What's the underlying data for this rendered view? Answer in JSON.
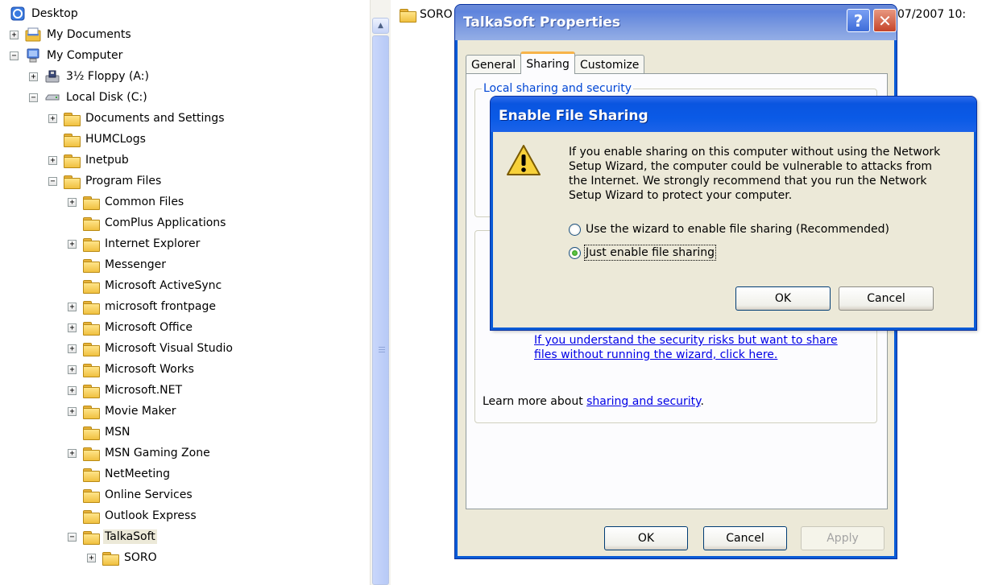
{
  "tree": {
    "items": [
      {
        "label": "Desktop",
        "indent": 0,
        "expander": "",
        "icon": "desktop-icon"
      },
      {
        "label": "My Documents",
        "indent": 0,
        "expander": "+",
        "icon": "my-documents-icon"
      },
      {
        "label": "My Computer",
        "indent": 0,
        "expander": "−",
        "icon": "my-computer-icon"
      },
      {
        "label": "3½ Floppy (A:)",
        "indent": 1,
        "expander": "+",
        "icon": "floppy-drive-icon"
      },
      {
        "label": "Local Disk (C:)",
        "indent": 1,
        "expander": "−",
        "icon": "hard-disk-icon"
      },
      {
        "label": "Documents and Settings",
        "indent": 2,
        "expander": "+",
        "icon": "folder-icon"
      },
      {
        "label": "HUMCLogs",
        "indent": 2,
        "expander": "",
        "icon": "folder-icon"
      },
      {
        "label": "Inetpub",
        "indent": 2,
        "expander": "+",
        "icon": "folder-icon"
      },
      {
        "label": "Program Files",
        "indent": 2,
        "expander": "−",
        "icon": "folder-icon"
      },
      {
        "label": "Common Files",
        "indent": 3,
        "expander": "+",
        "icon": "folder-icon"
      },
      {
        "label": "ComPlus Applications",
        "indent": 3,
        "expander": "",
        "icon": "folder-icon"
      },
      {
        "label": "Internet Explorer",
        "indent": 3,
        "expander": "+",
        "icon": "folder-icon"
      },
      {
        "label": "Messenger",
        "indent": 3,
        "expander": "",
        "icon": "folder-icon"
      },
      {
        "label": "Microsoft ActiveSync",
        "indent": 3,
        "expander": "",
        "icon": "folder-icon"
      },
      {
        "label": "microsoft frontpage",
        "indent": 3,
        "expander": "+",
        "icon": "folder-icon"
      },
      {
        "label": "Microsoft Office",
        "indent": 3,
        "expander": "+",
        "icon": "folder-icon"
      },
      {
        "label": "Microsoft Visual Studio",
        "indent": 3,
        "expander": "+",
        "icon": "folder-icon"
      },
      {
        "label": "Microsoft Works",
        "indent": 3,
        "expander": "+",
        "icon": "folder-icon"
      },
      {
        "label": "Microsoft.NET",
        "indent": 3,
        "expander": "+",
        "icon": "folder-icon"
      },
      {
        "label": "Movie Maker",
        "indent": 3,
        "expander": "+",
        "icon": "folder-icon"
      },
      {
        "label": "MSN",
        "indent": 3,
        "expander": "",
        "icon": "folder-icon"
      },
      {
        "label": "MSN Gaming Zone",
        "indent": 3,
        "expander": "+",
        "icon": "folder-icon"
      },
      {
        "label": "NetMeeting",
        "indent": 3,
        "expander": "",
        "icon": "folder-icon"
      },
      {
        "label": "Online Services",
        "indent": 3,
        "expander": "",
        "icon": "folder-icon"
      },
      {
        "label": "Outlook Express",
        "indent": 3,
        "expander": "",
        "icon": "folder-icon"
      },
      {
        "label": "TalkaSoft",
        "indent": 3,
        "expander": "−",
        "icon": "folder-icon",
        "selected": true
      },
      {
        "label": "SORO",
        "indent": 4,
        "expander": "+",
        "icon": "folder-icon"
      }
    ]
  },
  "list": {
    "item_label": "SORO",
    "date_text": "07/2007 10:"
  },
  "properties_dialog": {
    "title": "TalkaSoft Properties",
    "help_glyph": "?",
    "close_glyph": "✕",
    "tabs": [
      {
        "label": "General",
        "active": false
      },
      {
        "label": "Sharing",
        "active": true
      },
      {
        "label": "Customize",
        "active": false
      }
    ],
    "group_title": "Local sharing and security",
    "link_line1": "If you understand the security risks but want to share",
    "link_line2": "files without running the wizard, click here.",
    "learn_more_prefix": "Learn more about ",
    "learn_more_link": "sharing and security",
    "learn_more_suffix": ".",
    "ok_label": "OK",
    "cancel_label": "Cancel",
    "apply_label": "Apply"
  },
  "share_dialog": {
    "title": "Enable File Sharing",
    "message_lines": [
      "If you enable sharing on this computer without using the Network",
      "Setup Wizard, the computer could be vulnerable to attacks from",
      "the Internet. We strongly recommend that you run the Network",
      "Setup Wizard to protect your computer."
    ],
    "options": [
      {
        "label": "Use the wizard to enable file sharing (Recommended)",
        "selected": false
      },
      {
        "label": "Just enable file sharing",
        "selected": true
      }
    ],
    "ok_label": "OK",
    "cancel_label": "Cancel"
  },
  "colors": {
    "xp_blue": "#0a5bd6",
    "dialog_face": "#ece9d8",
    "link": "#0000e6",
    "tab_highlight": "#f7b44a"
  }
}
